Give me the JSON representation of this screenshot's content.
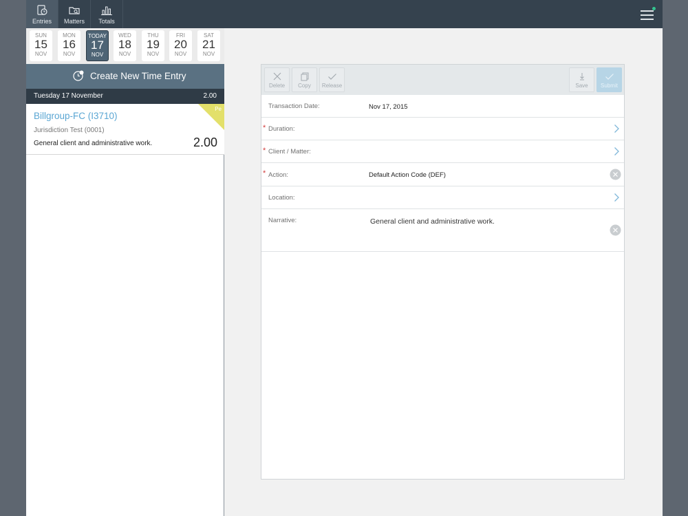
{
  "nav": {
    "tabs": [
      {
        "label": "Entries",
        "icon": "entries-icon"
      },
      {
        "label": "Matters",
        "icon": "matters-icon"
      },
      {
        "label": "Totals",
        "icon": "totals-icon"
      }
    ],
    "active_tab": "Entries"
  },
  "week": {
    "days": [
      {
        "name": "SUN",
        "date": "15",
        "month": "NOV"
      },
      {
        "name": "MON",
        "date": "16",
        "month": "NOV"
      },
      {
        "name": "TODAY",
        "date": "17",
        "month": "NOV"
      },
      {
        "name": "WED",
        "date": "18",
        "month": "NOV"
      },
      {
        "name": "THU",
        "date": "19",
        "month": "NOV"
      },
      {
        "name": "FRI",
        "date": "20",
        "month": "NOV"
      },
      {
        "name": "SAT",
        "date": "21",
        "month": "NOV"
      }
    ]
  },
  "create_entry": {
    "label": "Create New Time Entry"
  },
  "day_group": {
    "title": "Tuesday  17 November",
    "total": "2.00"
  },
  "entry": {
    "client": "Billgroup-FC (I3710)",
    "matter": "Jurisdiction Test (0001)",
    "narrative": "General client and administrative work.",
    "hours": "2.00",
    "flag": "Pe",
    "flag_color": "#e3e06a"
  },
  "toolbar": {
    "delete": "Delete",
    "copy": "Copy",
    "release": "Release",
    "save": "Save",
    "submit": "Submit"
  },
  "form": {
    "transaction_date_label": "Transaction Date:",
    "transaction_date_value": "Nov 17, 2015",
    "duration_label": "Duration:",
    "client_matter_label": "Client / Matter:",
    "action_label": "Action:",
    "action_value": "Default Action Code (DEF)",
    "location_label": "Location:",
    "narrative_label": "Narrative:",
    "narrative_value": "General client and administrative work.",
    "required_mark": "*"
  },
  "colors": {
    "topbar": "#35424e",
    "accent_link": "#5aa6d3",
    "required": "#d13b3b",
    "status_dot": "#34c38f"
  }
}
